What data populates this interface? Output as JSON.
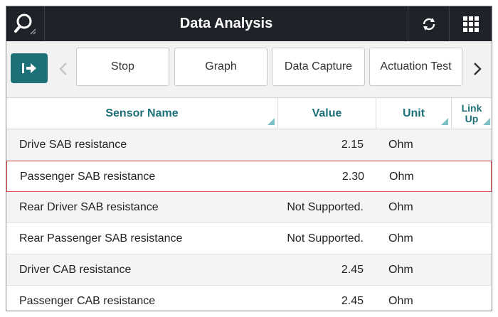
{
  "window": {
    "title": "Data Analysis",
    "icons": {
      "search": "search-icon",
      "refresh": "refresh-icon",
      "menu": "grid-menu-icon"
    },
    "colors": {
      "titlebar": "#1f2228",
      "accent": "#1d6f78",
      "highlight_border": "#e05050"
    }
  },
  "toolbar": {
    "exit_icon": "exit-arrow-icon",
    "buttons": [
      "Stop",
      "Graph",
      "Data Capture",
      "Actuation Test"
    ]
  },
  "table": {
    "headers": {
      "sensor_name": "Sensor Name",
      "value": "Value",
      "unit": "Unit",
      "link_up_line1": "Link",
      "link_up_line2": "Up"
    },
    "rows": [
      {
        "name": "Drive SAB resistance",
        "value": "2.15",
        "unit": "Ohm",
        "selected": false
      },
      {
        "name": "Passenger SAB resistance",
        "value": "2.30",
        "unit": "Ohm",
        "selected": true
      },
      {
        "name": "Rear Driver SAB resistance",
        "value": "Not Supported.",
        "unit": "Ohm",
        "selected": false
      },
      {
        "name": "Rear Passenger SAB resistance",
        "value": "Not Supported.",
        "unit": "Ohm",
        "selected": false
      },
      {
        "name": "Driver CAB resistance",
        "value": "2.45",
        "unit": "Ohm",
        "selected": false
      },
      {
        "name": "Passenger CAB resistance",
        "value": "2.45",
        "unit": "Ohm",
        "selected": false
      }
    ]
  }
}
